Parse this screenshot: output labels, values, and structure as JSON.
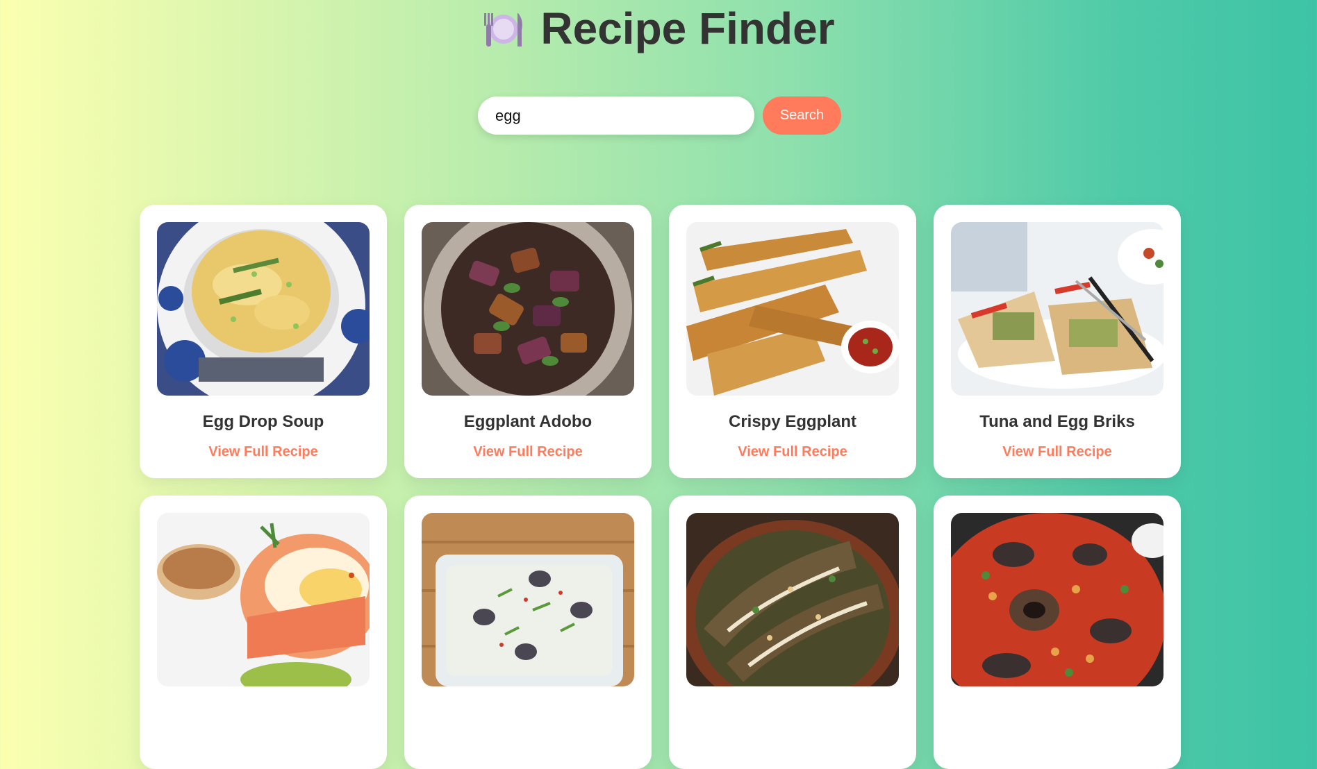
{
  "header": {
    "icon": "fork-plate-knife-icon",
    "title": "Recipe Finder"
  },
  "search": {
    "value": "egg",
    "button_label": "Search"
  },
  "colors": {
    "accent": "#ff7b5c",
    "card": "#ffffff",
    "title": "#333333"
  },
  "recipes": [
    {
      "title": "Egg Drop Soup",
      "link": "View Full Recipe",
      "image": "egg-drop-soup-photo"
    },
    {
      "title": "Eggplant Adobo",
      "link": "View Full Recipe",
      "image": "eggplant-adobo-photo"
    },
    {
      "title": "Crispy Eggplant",
      "link": "View Full Recipe",
      "image": "crispy-eggplant-photo"
    },
    {
      "title": "Tuna and Egg Briks",
      "link": "View Full Recipe",
      "image": "tuna-egg-briks-photo"
    },
    {
      "title": "",
      "link": "",
      "image": "eggs-benedict-salmon-photo"
    },
    {
      "title": "",
      "link": "",
      "image": "eggplant-yogurt-dish-photo"
    },
    {
      "title": "",
      "link": "",
      "image": "eggplant-tahini-pan-photo"
    },
    {
      "title": "",
      "link": "",
      "image": "eggplant-chickpea-skillet-photo"
    }
  ]
}
